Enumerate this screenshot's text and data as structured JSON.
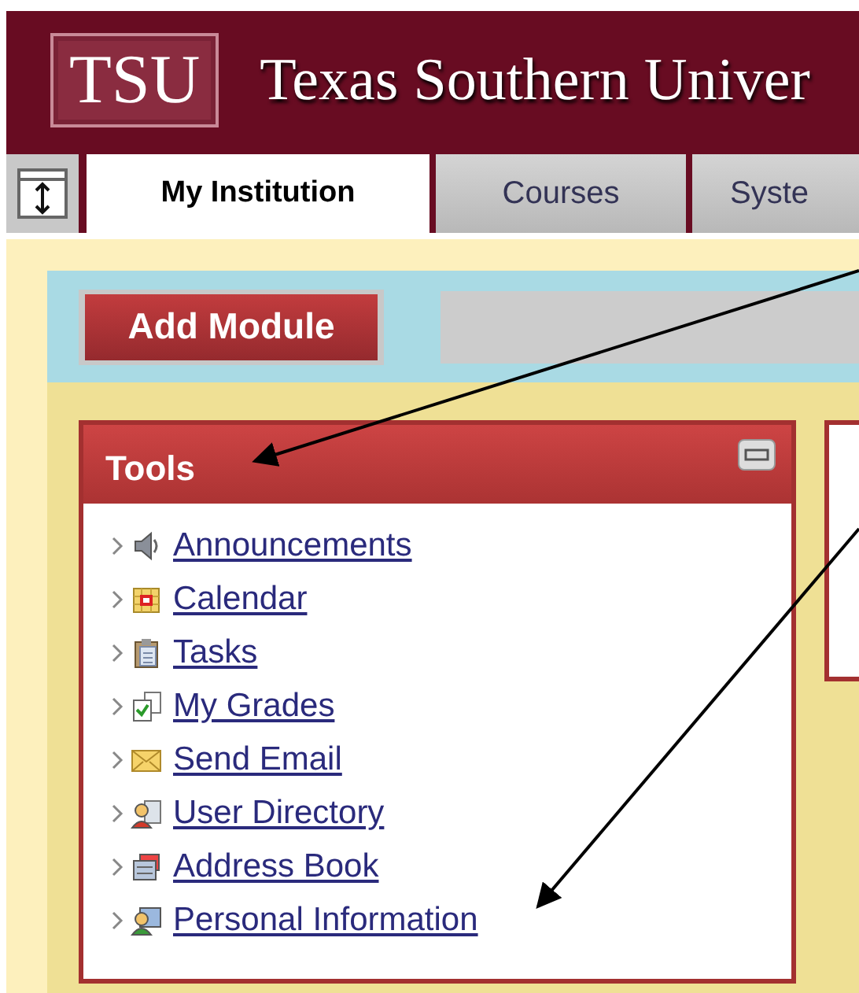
{
  "header": {
    "logo": "TSU",
    "title": "Texas Southern Univer"
  },
  "tabs": [
    {
      "label": "My Institution",
      "selected": true
    },
    {
      "label": "Courses",
      "selected": false
    },
    {
      "label": "Syste",
      "selected": false
    }
  ],
  "toolbar": {
    "button": "Add Module"
  },
  "module": {
    "title": "Tools",
    "links": [
      "Announcements",
      "Calendar",
      "Tasks",
      "My Grades",
      "Send Email",
      "User Directory",
      "Address Book",
      "Personal Information"
    ]
  }
}
